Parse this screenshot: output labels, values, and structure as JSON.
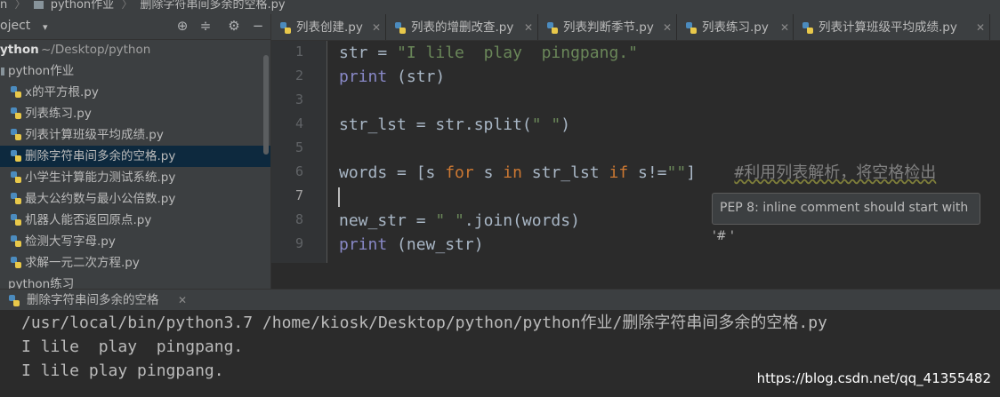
{
  "breadcrumb": {
    "root": "n",
    "folder": "python作业",
    "file": "删除字符串间多余的空格.py"
  },
  "project_panel": {
    "title": "oject",
    "root": {
      "name": "ython",
      "path": "~/Desktop/python"
    },
    "folder": "python作业",
    "files": [
      {
        "name": "x的平方根.py",
        "selected": false
      },
      {
        "name": "列表练习.py",
        "selected": false
      },
      {
        "name": "列表计算班级平均成绩.py",
        "selected": false
      },
      {
        "name": "删除字符串间多余的空格.py",
        "selected": true
      },
      {
        "name": "小学生计算能力测试系统.py",
        "selected": false
      },
      {
        "name": "最大公约数与最小公倍数.py",
        "selected": false
      },
      {
        "name": "机器人能否返回原点.py",
        "selected": false
      },
      {
        "name": "检测大写字母.py",
        "selected": false
      },
      {
        "name": "求解一元二次方程.py",
        "selected": false
      }
    ],
    "next_folder": "python练习",
    "toolbar_icons": [
      "target-icon",
      "collapse-icon",
      "gear-icon",
      "minimize-icon"
    ]
  },
  "tabs": [
    {
      "label": "列表创建.py"
    },
    {
      "label": "列表的增删改查.py"
    },
    {
      "label": "列表判断季节.py"
    },
    {
      "label": "列表练习.py"
    },
    {
      "label": "列表计算班级平均成绩.py"
    }
  ],
  "editor": {
    "line_numbers": [
      "1",
      "2",
      "3",
      "4",
      "5",
      "6",
      "7",
      "8",
      "9"
    ],
    "lines": [
      [
        [
          "v",
          "str = "
        ],
        [
          "s",
          "\"I lile  play  pingpang.\""
        ]
      ],
      [
        [
          "f",
          "print"
        ],
        [
          "v",
          " (str)"
        ]
      ],
      [],
      [
        [
          "v",
          "str_lst = str.split("
        ],
        [
          "s",
          "\" \""
        ],
        [
          "v",
          ")"
        ]
      ],
      [],
      [
        [
          "v",
          "words = [s "
        ],
        [
          "k",
          "for"
        ],
        [
          "v",
          " s "
        ],
        [
          "k",
          "in"
        ],
        [
          "v",
          " str_lst "
        ],
        [
          "k",
          "if"
        ],
        [
          "v",
          " s!="
        ],
        [
          "s",
          "\"\""
        ],
        [
          "v",
          "]    "
        ],
        [
          "c",
          "#利用列表解析，将空格检出"
        ]
      ],
      [],
      [
        [
          "v",
          "new_str = "
        ],
        [
          "s",
          "\" \""
        ],
        [
          "v",
          ".join(words)"
        ]
      ],
      [
        [
          "f",
          "print"
        ],
        [
          "v",
          " (new_str)"
        ]
      ]
    ],
    "tooltip": "PEP 8: inline comment should start with '# '"
  },
  "run": {
    "tab_label": "删除字符串间多余的空格",
    "output": [
      "/usr/local/bin/python3.7 /home/kiosk/Desktop/python/python作业/删除字符串间多余的空格.py",
      "I lile  play  pingpang.",
      "I lile play pingpang."
    ]
  },
  "watermark": "https://blog.csdn.net/qq_41355482",
  "colors": {
    "keyword": "#cc7832",
    "string": "#6a8759",
    "builtin": "#8888c6",
    "comment": "#808080",
    "selection": "#0d293e"
  }
}
